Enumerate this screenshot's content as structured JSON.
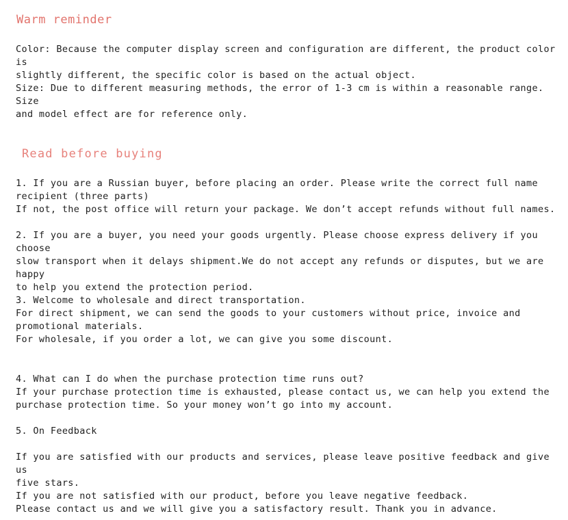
{
  "document": {
    "type": "product-listing-policy-notice",
    "background_color": "#ffffff",
    "text_color": "#202020",
    "accent_color": "#e2736c"
  },
  "sections": {
    "warm_reminder": {
      "heading": "Warm reminder",
      "heading_color": "#e2736c",
      "paragraphs": {
        "color_note": "Color: Because the computer display screen and configuration are different, the product color is\nslightly different, the specific color is based on the actual object.",
        "size_note": "Size: Due to different measuring methods, the error of 1-3 cm is within a reasonable range. Size\nand model effect are for reference only."
      }
    },
    "read_before_buying": {
      "heading": "Read before buying",
      "heading_color": "#e7817b",
      "items": {
        "item1": "1. If you are a Russian buyer, before placing an order. Please write the correct full name\nrecipient (three parts)\nIf not, the post office will return your package. We don’t accept refunds without full names.",
        "item2": "2. If you are a buyer, you need your goods urgently. Please choose express delivery if you choose\nslow transport when it delays shipment.We do not accept any refunds or disputes, but we are happy\nto help you extend the protection period.",
        "item3": "3. Welcome to wholesale and direct transportation.\nFor direct shipment, we can send the goods to your customers without price, invoice and\npromotional materials.\nFor wholesale, if you order a lot, we can give you some discount.",
        "item4": "4. What can I do when the purchase protection time runs out?\nIf your purchase protection time is exhausted, please contact us, we can help you extend the\npurchase protection time. So your money won’t go into my account.",
        "item5_heading": "5. On Feedback",
        "item5_body": "If you are satisfied with our products and services, please leave positive feedback and give us\nfive stars.\nIf you are not satisfied with our product, before you leave negative feedback.\nPlease contact us and we will give you a satisfactory result. Thank you in advance."
      }
    }
  }
}
